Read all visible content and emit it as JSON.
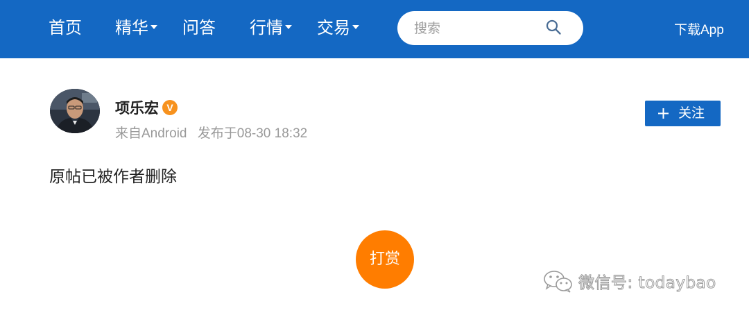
{
  "nav": {
    "home": "首页",
    "featured": "精华",
    "qa": "问答",
    "market": "行情",
    "trade": "交易"
  },
  "search": {
    "placeholder": "搜索"
  },
  "download_label": "下载App",
  "post": {
    "author": "项乐宏",
    "verified_badge": "V",
    "source": "来自Android",
    "published": "发布于08-30 18:32",
    "follow_label": "关注",
    "content": "原帖已被作者删除",
    "reward_label": "打赏"
  },
  "watermark": "微信号: todaybao",
  "colors": {
    "topbar": "#1468c3",
    "reward": "#ff7d00",
    "verified": "#f7921e",
    "meta_text": "#999999"
  }
}
